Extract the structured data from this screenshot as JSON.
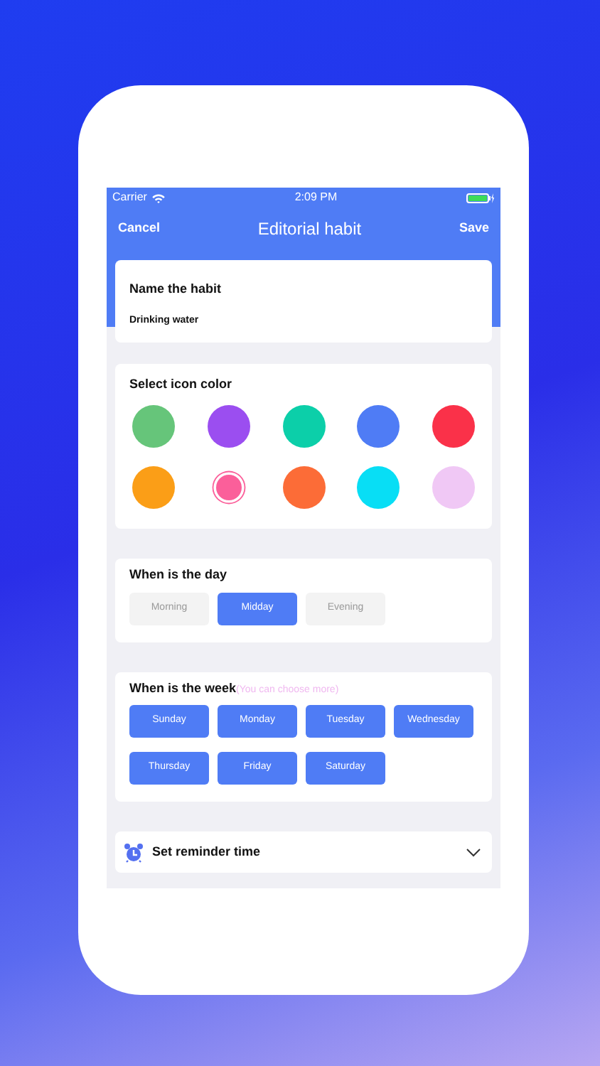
{
  "status_bar": {
    "carrier": "Carrier",
    "time": "2:09 PM"
  },
  "nav": {
    "cancel": "Cancel",
    "title": "Editorial habit",
    "save": "Save"
  },
  "name_card": {
    "title": "Name the habit",
    "value": "Drinking water"
  },
  "color_card": {
    "title": "Select icon color",
    "colors": [
      {
        "color": "#66c57a",
        "selected": false
      },
      {
        "color": "#9b4ef0",
        "selected": false
      },
      {
        "color": "#0ccfa9",
        "selected": false
      },
      {
        "color": "#4f7cf5",
        "selected": false
      },
      {
        "color": "#fa3149",
        "selected": false
      },
      {
        "color": "#fb9e17",
        "selected": false
      },
      {
        "color": "#fb5f9a",
        "selected": true
      },
      {
        "color": "#fc6c37",
        "selected": false
      },
      {
        "color": "#08def5",
        "selected": false
      },
      {
        "color": "#f0c8f5",
        "selected": false
      }
    ]
  },
  "day_card": {
    "title": "When is the day",
    "options": [
      {
        "label": "Morning",
        "selected": false
      },
      {
        "label": "Midday",
        "selected": true
      },
      {
        "label": "Evening",
        "selected": false
      }
    ]
  },
  "week_card": {
    "title": "When is the week",
    "hint": "(You can choose more)",
    "options": [
      {
        "label": "Sunday",
        "selected": true
      },
      {
        "label": "Monday",
        "selected": true
      },
      {
        "label": "Tuesday",
        "selected": true
      },
      {
        "label": "Wednesday",
        "selected": true
      },
      {
        "label": "Thursday",
        "selected": true
      },
      {
        "label": "Friday",
        "selected": true
      },
      {
        "label": "Saturday",
        "selected": true
      }
    ]
  },
  "reminder": {
    "label": "Set reminder time",
    "expanded": false
  }
}
